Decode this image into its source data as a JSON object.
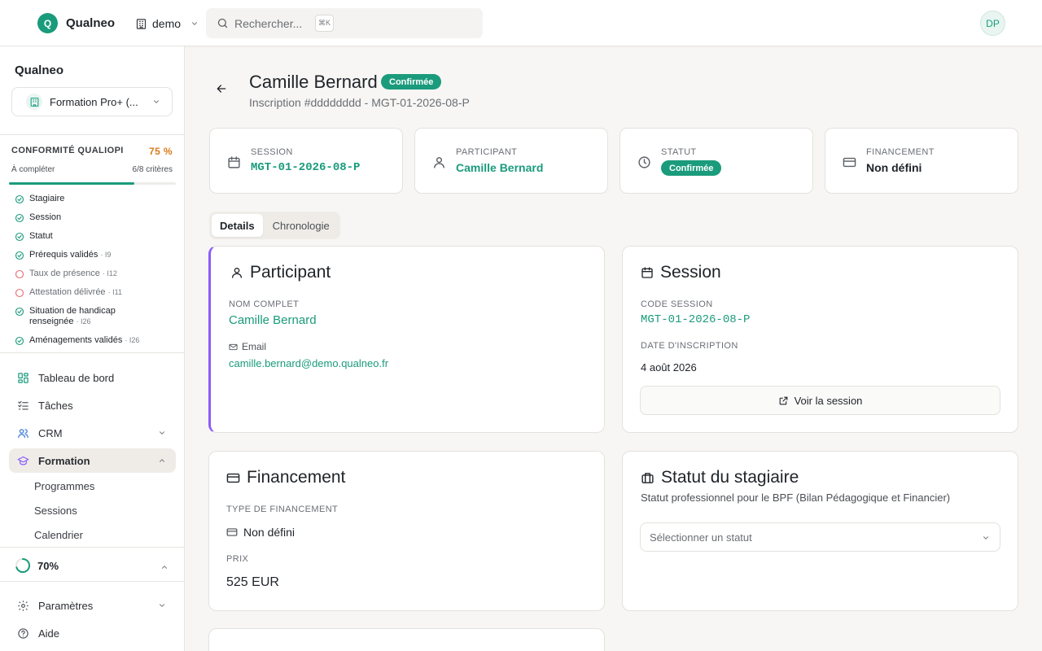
{
  "topbar": {
    "logo_letter": "Q",
    "brand": "Qualneo",
    "org": "demo",
    "search_placeholder": "Rechercher...",
    "search_shortcut": "⌘K",
    "avatar": "DP"
  },
  "sidebar": {
    "title": "Qualneo",
    "org_selector": "Formation Pro+ (...",
    "qualiopi": {
      "title": "CONFORMITÉ QUALIOPI",
      "percent": "75 %",
      "progress": 0.75,
      "subtitle": "À compléter",
      "criteria_count": "6/8 critères",
      "criteria": [
        {
          "label": "Stagiaire",
          "tag": "",
          "done": true
        },
        {
          "label": "Session",
          "tag": "",
          "done": true
        },
        {
          "label": "Statut",
          "tag": "",
          "done": true
        },
        {
          "label": "Prérequis validés",
          "tag": "· I9",
          "done": true
        },
        {
          "label": "Taux de présence",
          "tag": "· I12",
          "done": false
        },
        {
          "label": "Attestation délivrée",
          "tag": "· I11",
          "done": false
        },
        {
          "label": "Situation de handicap renseignée",
          "tag": "· I26",
          "done": true
        },
        {
          "label": "Aménagements validés",
          "tag": "· I26",
          "done": true
        }
      ]
    },
    "nav": [
      {
        "label": "Tableau de bord",
        "icon": "dashboard-icon"
      },
      {
        "label": "Tâches",
        "icon": "tasks-icon"
      },
      {
        "label": "CRM",
        "icon": "users-icon"
      },
      {
        "label": "Formation",
        "icon": "graduation-cap-icon"
      }
    ],
    "formation_sub": [
      "Programmes",
      "Sessions",
      "Calendrier"
    ],
    "setup_progress": "70%",
    "setup_progress_value": 0.7,
    "bottom_nav": [
      {
        "label": "Paramètres",
        "icon": "gear-icon"
      },
      {
        "label": "Aide",
        "icon": "help-icon"
      }
    ]
  },
  "header": {
    "title": "Camille Bernard",
    "status": "Confirmée",
    "subtitle": "Inscription #dddddddd - MGT-01-2026-08-P"
  },
  "stats": [
    {
      "label": "SESSION",
      "value": "MGT-01-2026-08-P",
      "icon": "calendar-icon"
    },
    {
      "label": "PARTICIPANT",
      "value": "Camille Bernard",
      "icon": "user-icon"
    },
    {
      "label": "STATUT",
      "value": "Confirmée",
      "icon": "clock-icon"
    },
    {
      "label": "FINANCEMENT",
      "value": "Non défini",
      "icon": "credit-card-icon"
    }
  ],
  "tabs": [
    "Details",
    "Chronologie"
  ],
  "participant_card": {
    "title": "Participant",
    "name_label": "NOM COMPLET",
    "name": "Camille Bernard",
    "email_label": "Email",
    "email": "camille.bernard@demo.qualneo.fr"
  },
  "session_card": {
    "title": "Session",
    "code_label": "CODE SESSION",
    "code": "MGT-01-2026-08-P",
    "date_label": "DATE D'INSCRIPTION",
    "date": "4 août 2026",
    "button": "Voir la session"
  },
  "financement_card": {
    "title": "Financement",
    "type_label": "TYPE DE FINANCEMENT",
    "type": "Non défini",
    "price_label": "PRIX",
    "price": "525 EUR"
  },
  "statut_card": {
    "title": "Statut du stagiaire",
    "subtitle": "Statut professionnel pour le BPF (Bilan Pédagogique et Financier)",
    "select_placeholder": "Sélectionner un statut"
  },
  "colors": {
    "accent": "#1a9b7c",
    "warning": "#d97a1a",
    "pending": "#e76f75",
    "participant_border": "#8b5cf6"
  }
}
